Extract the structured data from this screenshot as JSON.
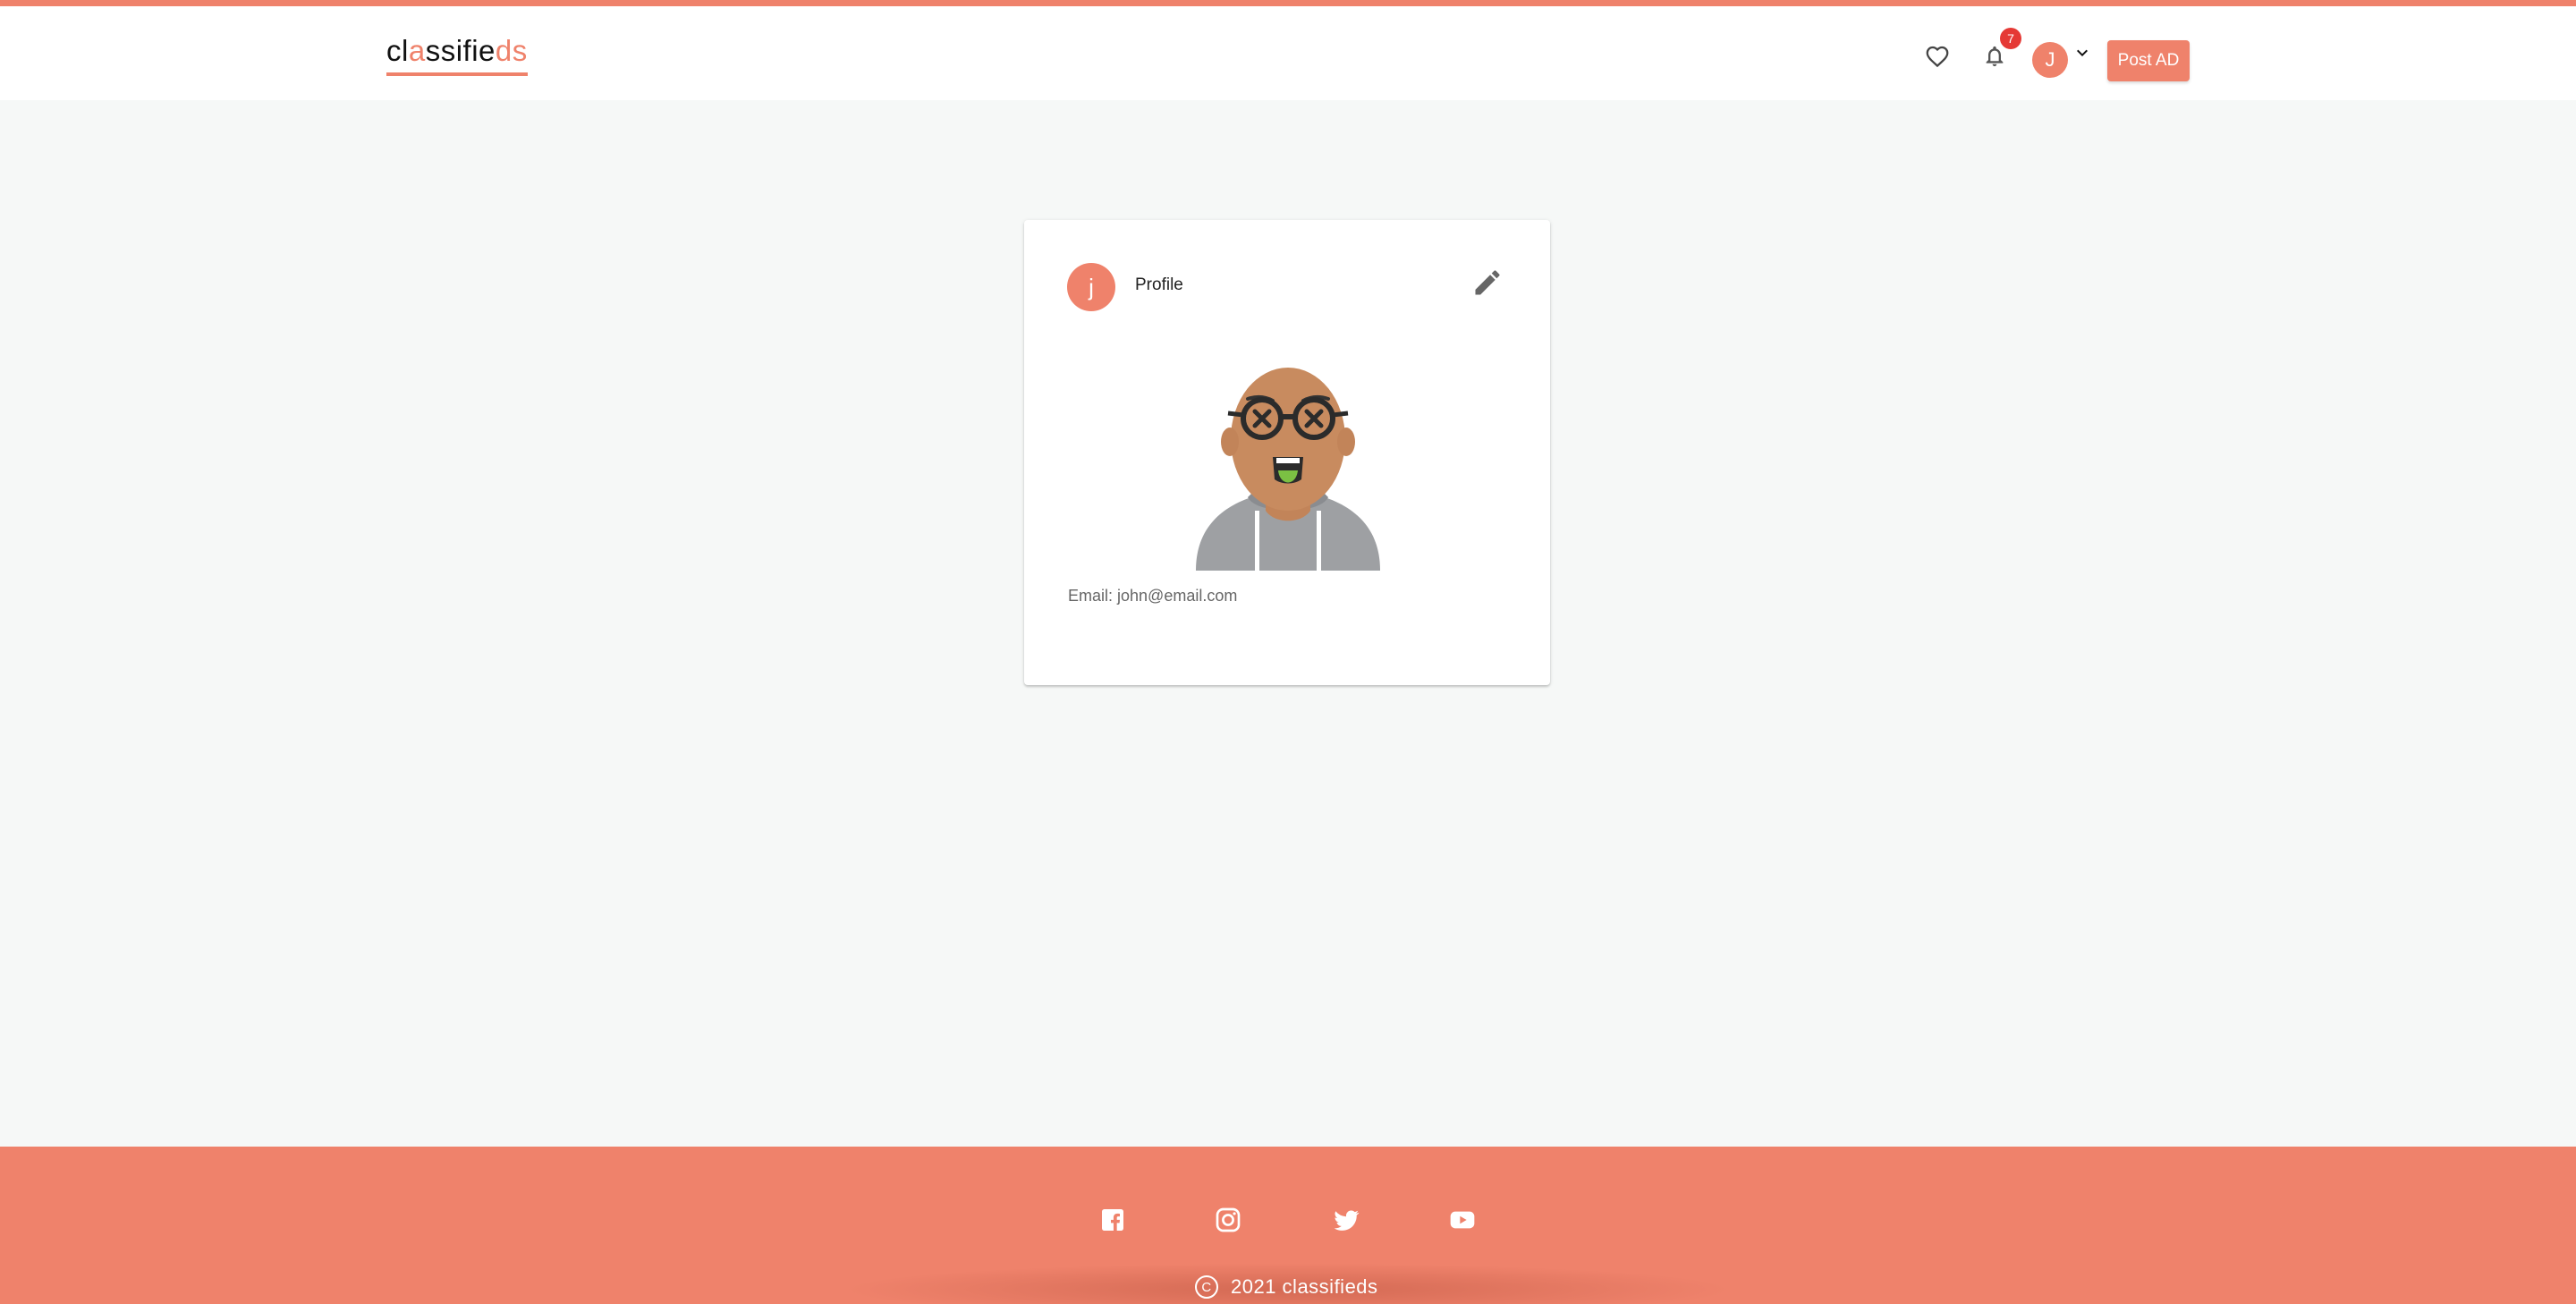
{
  "header": {
    "logo": {
      "part1": "cl",
      "part2": "a",
      "part3": "ssifie",
      "part4": "ds"
    },
    "notifications_count": "7",
    "user_initial": "J",
    "post_ad_label": "Post AD",
    "icons": [
      "heart-icon",
      "bell-icon",
      "chevron-down-icon"
    ]
  },
  "profile_card": {
    "avatar_initial": "j",
    "title": "Profile",
    "email_line": "Email: john@email.com",
    "icons": [
      "edit-icon"
    ]
  },
  "footer": {
    "social_icons": [
      "facebook-icon",
      "instagram-icon",
      "twitter-icon",
      "youtube-icon"
    ],
    "copyright_symbol": "C",
    "copyright_text": "2021 classifieds"
  },
  "colors": {
    "accent": "#ef826b",
    "page_background": "#f6f8f7",
    "badge": "#e53935"
  }
}
